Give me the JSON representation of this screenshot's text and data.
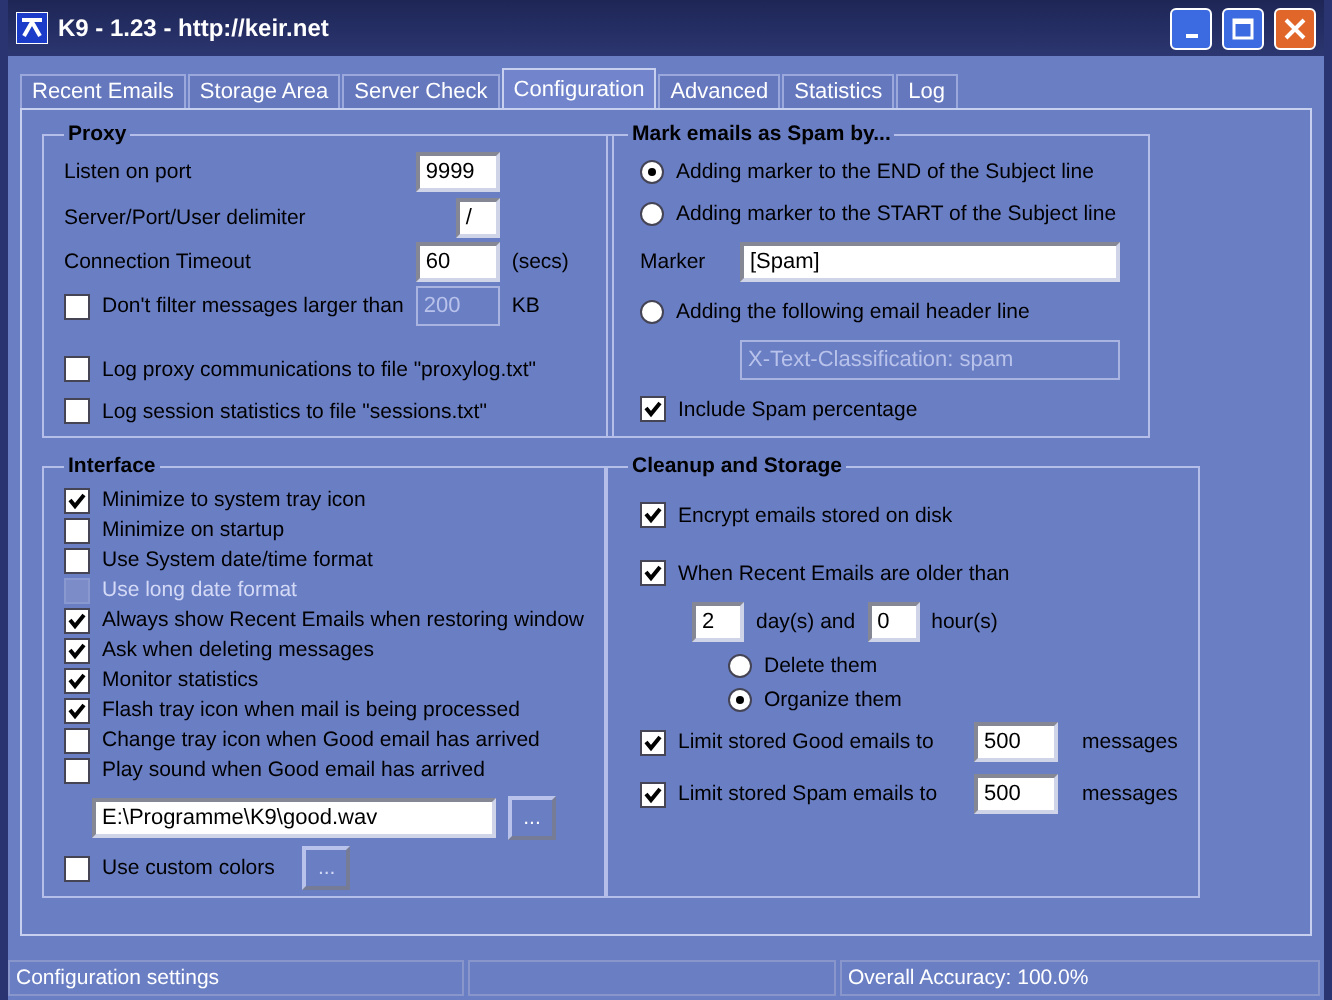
{
  "window": {
    "title": "K9 - 1.23 - http://keir.net"
  },
  "tabs": [
    {
      "label": "Recent Emails",
      "selected": false
    },
    {
      "label": "Storage Area",
      "selected": false
    },
    {
      "label": "Server Check",
      "selected": false
    },
    {
      "label": "Configuration",
      "selected": true
    },
    {
      "label": "Advanced",
      "selected": false
    },
    {
      "label": "Statistics",
      "selected": false
    },
    {
      "label": "Log",
      "selected": false
    }
  ],
  "proxy": {
    "title": "Proxy",
    "items": [
      {
        "kind": "field",
        "label": "Listen on port",
        "value": "9999",
        "disabled": false
      },
      {
        "kind": "field",
        "label": "Server/Port/User delimiter",
        "value": "/",
        "disabled": false
      },
      {
        "kind": "field",
        "label": "Connection Timeout",
        "value": "60",
        "unit": "(secs)",
        "disabled": false
      },
      {
        "kind": "checkfield",
        "label": "Don't filter messages larger than",
        "checked": false,
        "value": "200",
        "unit": "KB",
        "disabled": true
      },
      {
        "kind": "check",
        "label": "Log proxy communications to file \"proxylog.txt\"",
        "checked": false,
        "disabled": false
      },
      {
        "kind": "check",
        "label": "Log session statistics to file \"sessions.txt\"",
        "checked": false,
        "disabled": false
      }
    ]
  },
  "interface": {
    "title": "Interface",
    "items": [
      {
        "label": "Minimize to system tray icon",
        "checked": true,
        "disabled": false
      },
      {
        "label": "Minimize on startup",
        "checked": false,
        "disabled": false
      },
      {
        "label": "Use System date/time format",
        "checked": false,
        "disabled": false
      },
      {
        "label": "Use long date format",
        "checked": false,
        "disabled": true
      },
      {
        "label": "Always show Recent Emails when restoring window",
        "checked": true,
        "disabled": false
      },
      {
        "label": "Ask when deleting messages",
        "checked": true,
        "disabled": false
      },
      {
        "label": "Monitor statistics",
        "checked": true,
        "disabled": false
      },
      {
        "label": "Flash tray icon when mail is being processed",
        "checked": true,
        "disabled": false
      },
      {
        "label": "Change tray icon when Good email has arrived",
        "checked": false,
        "disabled": false
      },
      {
        "label": "Play sound when Good email has arrived",
        "checked": false,
        "disabled": false
      }
    ],
    "sound_file": {
      "value": "E:\\Programme\\K9\\good.wav",
      "button": "..."
    },
    "custom_colors": {
      "label": "Use custom colors",
      "checked": false,
      "button": "...",
      "disabled": true
    }
  },
  "spam": {
    "title": "Mark emails as Spam by...",
    "items": [
      {
        "kind": "radio",
        "label": "Adding marker to the END of the Subject line",
        "selected": true
      },
      {
        "kind": "radio",
        "label": "Adding marker to the START of the Subject line",
        "selected": false
      },
      {
        "kind": "field",
        "label": "Marker",
        "value": "[Spam]",
        "disabled": false
      },
      {
        "kind": "radio",
        "label": "Adding the following email header line",
        "selected": false
      },
      {
        "kind": "field",
        "value": "X-Text-Classification: spam",
        "disabled": true
      },
      {
        "kind": "check",
        "label": "Include Spam percentage",
        "checked": true,
        "disabled": false
      }
    ]
  },
  "cleanup": {
    "title": "Cleanup and Storage",
    "items": [
      {
        "kind": "check",
        "label": "Encrypt emails stored on disk",
        "checked": true
      },
      {
        "kind": "check",
        "label": "When Recent Emails are older than",
        "checked": true
      },
      {
        "kind": "age",
        "days": "2",
        "days_label": "day(s) and",
        "hours": "0",
        "hours_label": "hour(s)"
      },
      {
        "kind": "radio",
        "label": "Delete them",
        "selected": false
      },
      {
        "kind": "radio",
        "label": "Organize them",
        "selected": true
      },
      {
        "kind": "limit",
        "label": "Limit stored Good emails to",
        "checked": true,
        "value": "500",
        "unit": "messages"
      },
      {
        "kind": "limit",
        "label": "Limit stored Spam emails to",
        "checked": true,
        "value": "500",
        "unit": "messages"
      }
    ]
  },
  "status_bar": {
    "left": "Configuration settings",
    "right": "Overall Accuracy: 100.0%"
  }
}
